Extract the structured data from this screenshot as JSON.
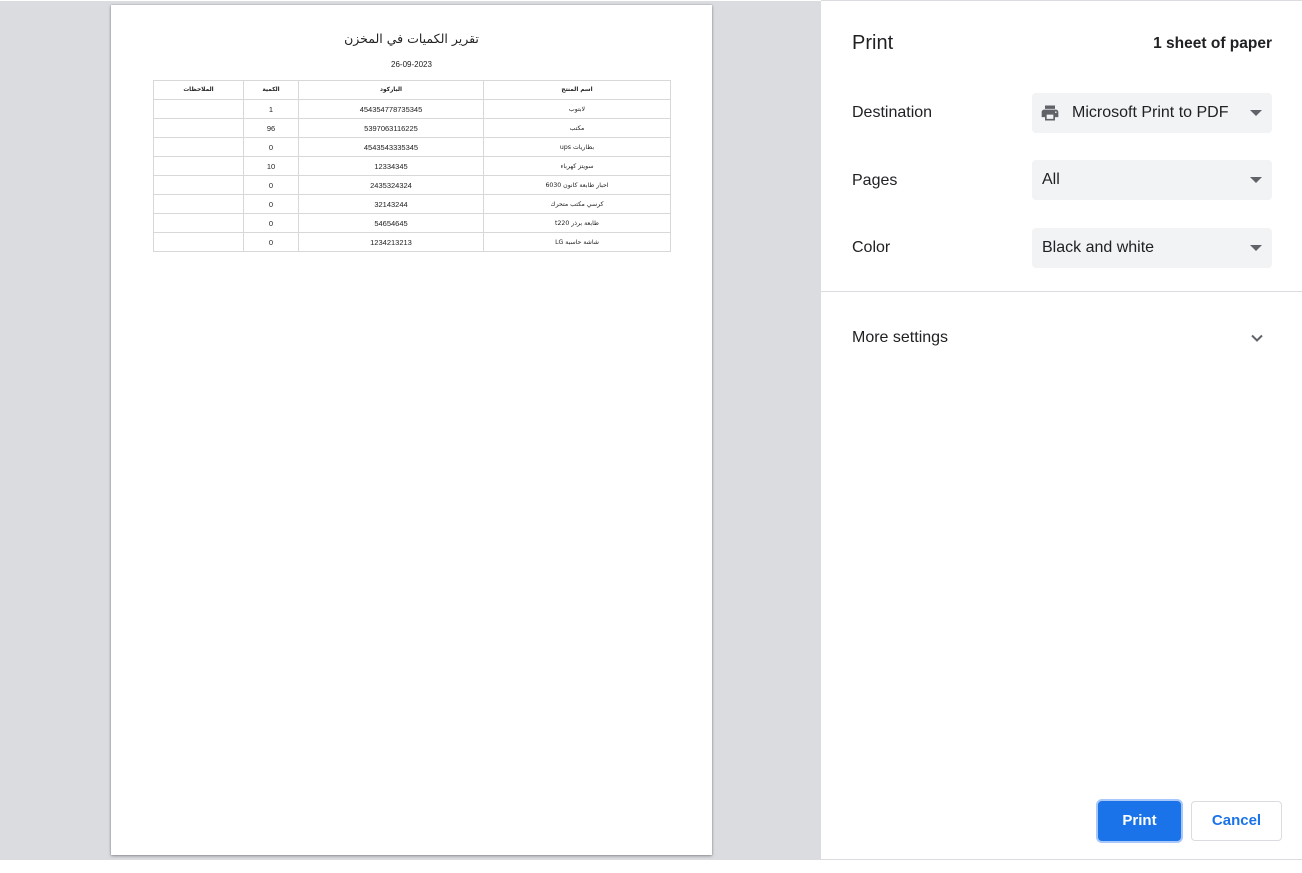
{
  "preview": {
    "report": {
      "title": "تقرير الكميات في المخزن",
      "date": "26-09-2023",
      "columns": [
        "اسم المنتج",
        "الباركود",
        "الكمية",
        "الملاحظات"
      ],
      "rows": [
        {
          "name": "لابتوب",
          "barcode": "454354778735345",
          "qty": "1",
          "notes": ""
        },
        {
          "name": "مكتب",
          "barcode": "5397063116225",
          "qty": "96",
          "notes": ""
        },
        {
          "name": "بطاريات ups",
          "barcode": "4543543335345",
          "qty": "0",
          "notes": ""
        },
        {
          "name": "سويتز كهرباء",
          "barcode": "12334345",
          "qty": "10",
          "notes": ""
        },
        {
          "name": "احبار طابعة كانون 6030",
          "barcode": "2435324324",
          "qty": "0",
          "notes": ""
        },
        {
          "name": "كرسي مكتب متحرك",
          "barcode": "32143244",
          "qty": "0",
          "notes": ""
        },
        {
          "name": "طابعة برذر t220",
          "barcode": "54654645",
          "qty": "0",
          "notes": ""
        },
        {
          "name": "شاشة حاسبة LG",
          "barcode": "1234213213",
          "qty": "0",
          "notes": ""
        }
      ]
    }
  },
  "panel": {
    "title": "Print",
    "sheet_count": "1 sheet of paper",
    "destination": {
      "label": "Destination",
      "value": "Microsoft Print to PDF",
      "icon": "printer-icon"
    },
    "pages": {
      "label": "Pages",
      "value": "All"
    },
    "color": {
      "label": "Color",
      "value": "Black and white"
    },
    "more_settings": {
      "label": "More settings",
      "icon": "chevron-down-icon"
    },
    "print_button": "Print",
    "cancel_button": "Cancel"
  },
  "colors": {
    "accent": "#1a73e8",
    "preview_background": "#dadce0",
    "select_background": "#f1f3f4"
  }
}
